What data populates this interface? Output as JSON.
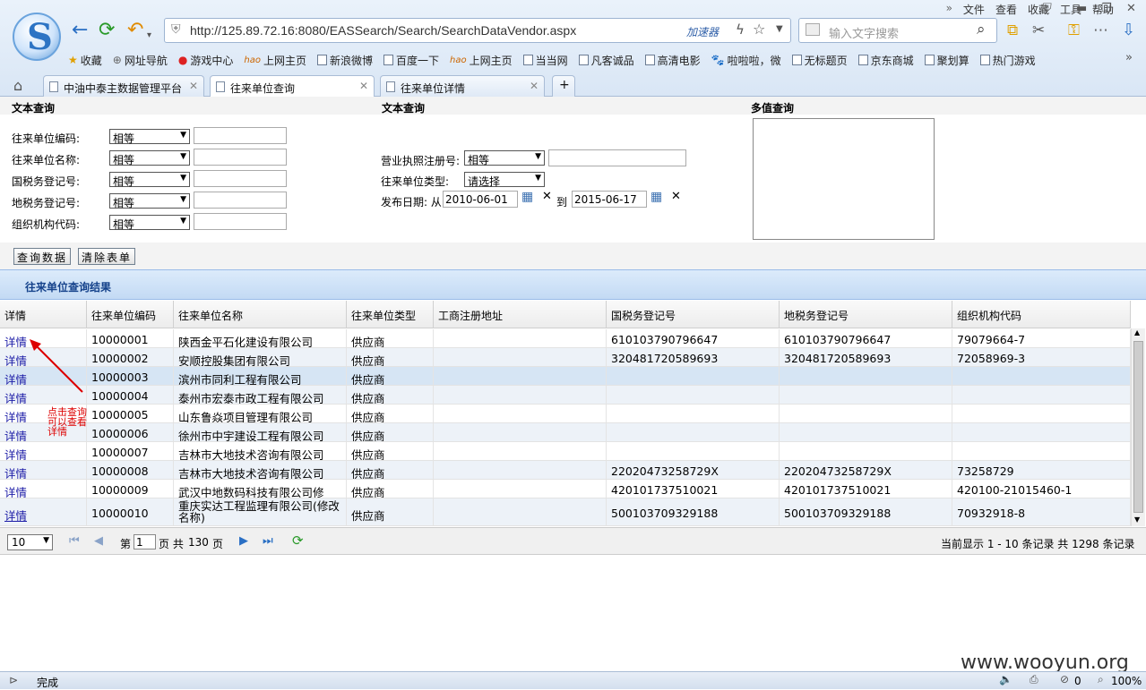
{
  "browser": {
    "menu": [
      "文件",
      "查看",
      "收藏",
      "工具",
      "帮助"
    ],
    "url": "http://125.89.72.16:8080/EASSearch/Search/SearchDataVendor.aspx",
    "accelerator": "加速器",
    "search_placeholder": "输入文字搜索",
    "bookmarks": [
      "收藏",
      "网址导航",
      "游戏中心",
      "上网主页",
      "新浪微博",
      "百度一下",
      "上网主页",
      "当当网",
      "凡客诚品",
      "高清电影",
      "啦啦啦，微",
      "无标题页",
      "京东商城",
      "聚划算",
      "热门游戏"
    ],
    "bookmarks_more": "»",
    "tabs": [
      {
        "label": "中油中泰主数据管理平台"
      },
      {
        "label": "往来单位查询"
      },
      {
        "label": "往来单位详情"
      }
    ],
    "new_tab": "+"
  },
  "query": {
    "col1_title": "文本查询",
    "col2_title": "文本查询",
    "col3_title": "多值查询",
    "fields_left": [
      {
        "label": "往来单位编码:",
        "op": "相等",
        "value": ""
      },
      {
        "label": "往来单位名称:",
        "op": "相等",
        "value": ""
      },
      {
        "label": "国税务登记号:",
        "op": "相等",
        "value": ""
      },
      {
        "label": "地税务登记号:",
        "op": "相等",
        "value": ""
      },
      {
        "label": "组织机构代码:",
        "op": "相等",
        "value": ""
      }
    ],
    "license_label": "营业执照注册号:",
    "license_op": "相等",
    "type_label": "往来单位类型:",
    "type_value": "请选择",
    "date_label": "发布日期: 从",
    "date_from": "2010-06-01",
    "date_to_label": "到",
    "date_to": "2015-06-17",
    "multi_value": ""
  },
  "buttons": {
    "query": "查询数据",
    "clear": "清除表单"
  },
  "results": {
    "title": "往来单位查询结果",
    "columns": [
      "详情",
      "往来单位编码",
      "往来单位名称",
      "往来单位类型",
      "工商注册地址",
      "国税务登记号",
      "地税务登记号",
      "组织机构代码"
    ],
    "rows": [
      {
        "detail": "详情",
        "code": "10000001",
        "name": "陕西金平石化建设有限公司",
        "type": "供应商",
        "addr": "",
        "nat_tax": "610103790796647",
        "local_tax": "610103790796647",
        "org": "79079664-7"
      },
      {
        "detail": "详情",
        "code": "10000002",
        "name": "安顺控股集团有限公司",
        "type": "供应商",
        "addr": "",
        "nat_tax": "320481720589693",
        "local_tax": "320481720589693",
        "org": "72058969-3"
      },
      {
        "detail": "详情",
        "code": "10000003",
        "name": "滨州市同利工程有限公司",
        "type": "供应商",
        "addr": "",
        "nat_tax": "",
        "local_tax": "",
        "org": ""
      },
      {
        "detail": "详情",
        "code": "10000004",
        "name": "泰州市宏泰市政工程有限公司",
        "type": "供应商",
        "addr": "",
        "nat_tax": "",
        "local_tax": "",
        "org": ""
      },
      {
        "detail": "详情",
        "code": "10000005",
        "name": "山东鲁焱项目管理有限公司",
        "type": "供应商",
        "addr": "",
        "nat_tax": "",
        "local_tax": "",
        "org": ""
      },
      {
        "detail": "详情",
        "code": "10000006",
        "name": "徐州市中宇建设工程有限公司",
        "type": "供应商",
        "addr": "",
        "nat_tax": "",
        "local_tax": "",
        "org": ""
      },
      {
        "detail": "详情",
        "code": "10000007",
        "name": "吉林市大地技术咨询有限公司",
        "type": "供应商",
        "addr": "",
        "nat_tax": "",
        "local_tax": "",
        "org": ""
      },
      {
        "detail": "详情",
        "code": "10000008",
        "name": "吉林市大地技术咨询有限公司",
        "type": "供应商",
        "addr": "",
        "nat_tax": "22020473258729X",
        "local_tax": "22020473258729X",
        "org": "73258729"
      },
      {
        "detail": "详情",
        "code": "10000009",
        "name": "武汉中地数码科技有限公司修",
        "type": "供应商",
        "addr": "",
        "nat_tax": "420101737510021",
        "local_tax": "420101737510021",
        "org": "420100-21015460-1"
      },
      {
        "detail": "详情",
        "code": "10000010",
        "name": "重庆实达工程监理有限公司(修改名称)",
        "type": "供应商",
        "addr": "",
        "nat_tax": "500103709329188",
        "local_tax": "500103709329188",
        "org": "70932918-8"
      }
    ]
  },
  "annotation": {
    "line1": "点击查询",
    "line2": "可以查看",
    "line3": "详情",
    "color": "#dd0000"
  },
  "pager": {
    "page_size": "10",
    "page_prefix": "第",
    "page": "1",
    "page_suffix": "页 共",
    "total_pages": "130",
    "pages_unit": "页",
    "summary": "当前显示 1 - 10 条记录 共 1298 条记录"
  },
  "statusbar": {
    "text": "完成",
    "zoom": "100%",
    "count": "0"
  },
  "watermark": "www.wooyun.org"
}
